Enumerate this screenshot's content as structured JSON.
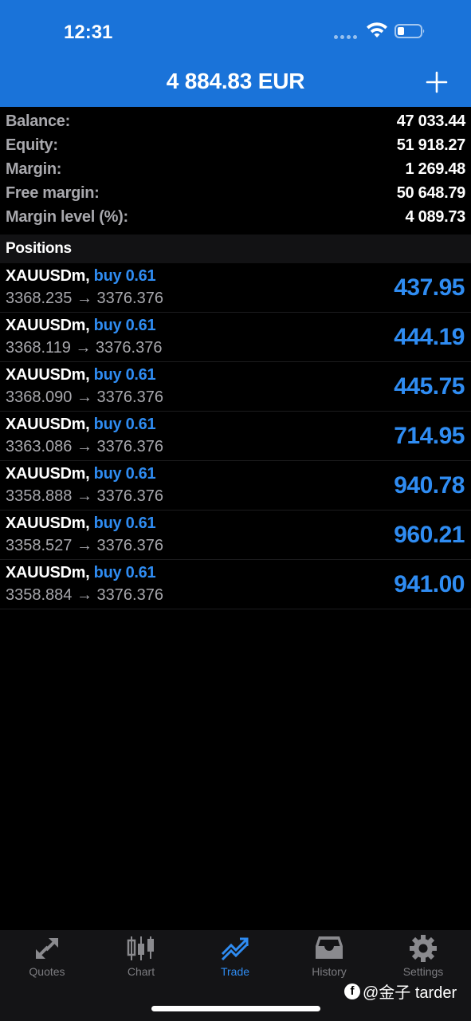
{
  "status_bar": {
    "time": "12:31"
  },
  "header": {
    "title": "4 884.83 EUR",
    "add_icon": "plus-icon"
  },
  "account": [
    {
      "label": "Balance:",
      "value": "47 033.44"
    },
    {
      "label": "Equity:",
      "value": "51 918.27"
    },
    {
      "label": "Margin:",
      "value": "1 269.48"
    },
    {
      "label": "Free margin:",
      "value": "50 648.79"
    },
    {
      "label": "Margin level (%):",
      "value": "4 089.73"
    }
  ],
  "positions_header": "Positions",
  "positions": [
    {
      "symbol": "XAUUSDm,",
      "side": "buy 0.61",
      "prices": "3368.235 → 3376.376",
      "profit": "437.95"
    },
    {
      "symbol": "XAUUSDm,",
      "side": "buy 0.61",
      "prices": "3368.119 → 3376.376",
      "profit": "444.19"
    },
    {
      "symbol": "XAUUSDm,",
      "side": "buy 0.61",
      "prices": "3368.090 → 3376.376",
      "profit": "445.75"
    },
    {
      "symbol": "XAUUSDm,",
      "side": "buy 0.61",
      "prices": "3363.086 → 3376.376",
      "profit": "714.95"
    },
    {
      "symbol": "XAUUSDm,",
      "side": "buy 0.61",
      "prices": "3358.888 → 3376.376",
      "profit": "940.78"
    },
    {
      "symbol": "XAUUSDm,",
      "side": "buy 0.61",
      "prices": "3358.527 → 3376.376",
      "profit": "960.21"
    },
    {
      "symbol": "XAUUSDm,",
      "side": "buy 0.61",
      "prices": "3358.884 → 3376.376",
      "profit": "941.00"
    }
  ],
  "tabs": [
    {
      "label": "Quotes",
      "icon": "quotes-arrows-icon"
    },
    {
      "label": "Chart",
      "icon": "candlestick-icon"
    },
    {
      "label": "Trade",
      "icon": "trade-trend-icon",
      "active": true
    },
    {
      "label": "History",
      "icon": "inbox-tray-icon"
    },
    {
      "label": "Settings",
      "icon": "gear-icon"
    }
  ],
  "watermark": {
    "text": "@金子 tarder"
  },
  "colors": {
    "header_blue": "#1a73d9",
    "accent_blue": "#2f8cf2",
    "muted_gray": "#a8a8ad",
    "background": "#000000"
  }
}
